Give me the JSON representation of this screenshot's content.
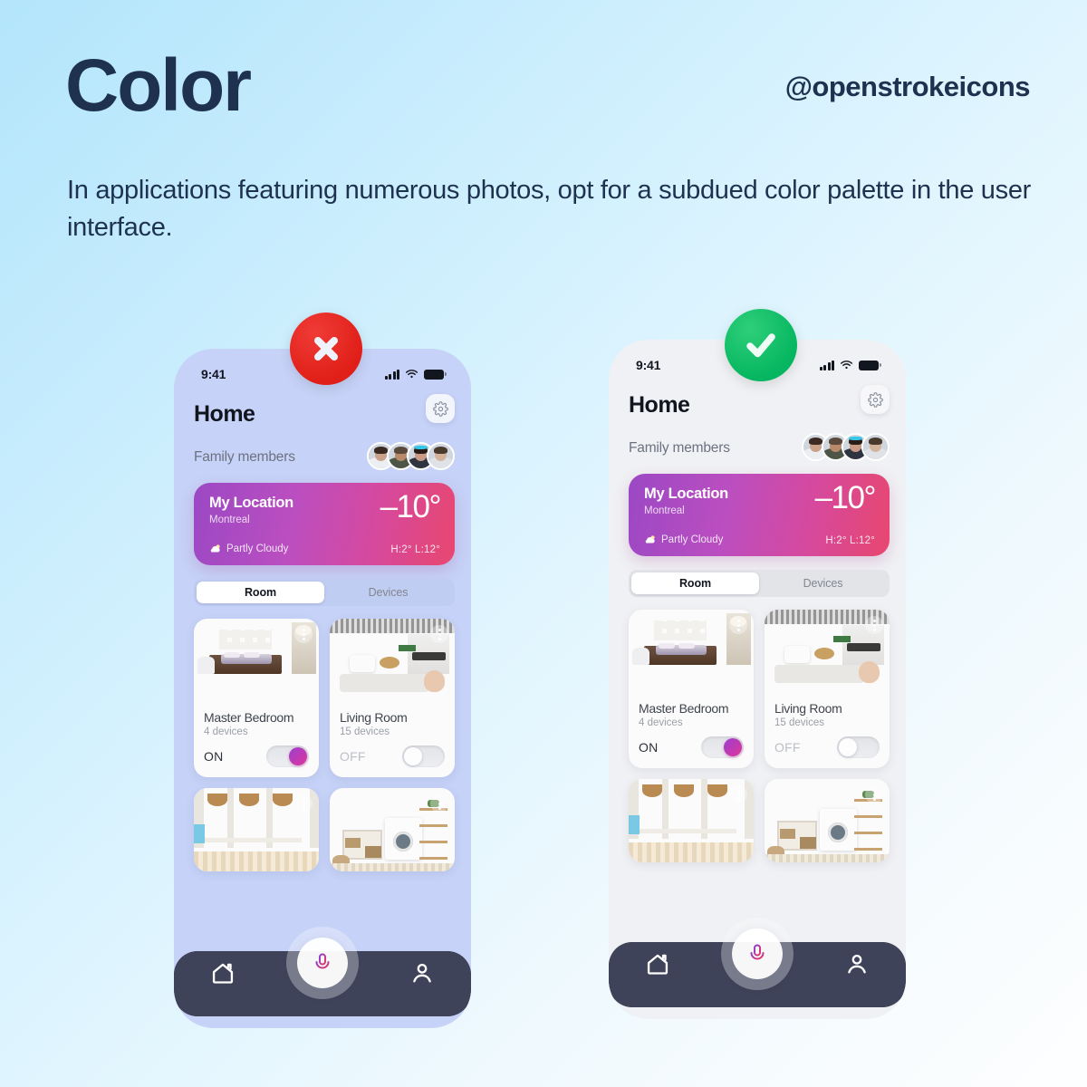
{
  "header": {
    "title": "Color",
    "handle": "@openstrokeicons",
    "subtitle": "In applications featuring numerous photos, opt for a subdued color palette in the user interface."
  },
  "colors": {
    "page_bg_start": "#b3e5fb",
    "page_bg_end": "#fdfeff",
    "ink": "#1e3250",
    "bad_badge": "#e01f18",
    "good_badge": "#05b55f",
    "weather_gradient_start": "#9b48c4",
    "weather_gradient_end": "#e8476f",
    "nav_bar": "#3e4359",
    "toggle_on": "#e0369a",
    "phone_left_bg": "#c6d2f7",
    "phone_right_bg": "#f0f1f4"
  },
  "badges": {
    "bad": {
      "icon": "cross-icon",
      "label": "Incorrect example"
    },
    "good": {
      "icon": "check-icon",
      "label": "Correct example"
    }
  },
  "app": {
    "status_bar": {
      "time": "9:41",
      "signal_icon": "cellular-bars-icon",
      "wifi_icon": "wifi-icon",
      "battery_icon": "battery-full-icon"
    },
    "title": "Home",
    "settings_icon": "gear-icon",
    "family": {
      "label": "Family members",
      "avatar_count": 4
    },
    "weather": {
      "location": "My Location",
      "city": "Montreal",
      "temperature": "–10°",
      "condition": "Partly Cloudy",
      "condition_icon": "partly-cloudy-icon",
      "high_low": "H:2°  L:12°"
    },
    "tabs": [
      {
        "label": "Room",
        "active": true
      },
      {
        "label": "Devices",
        "active": false
      }
    ],
    "rooms": [
      {
        "name": "Master Bedroom",
        "devices": "4 devices",
        "state": "ON",
        "on": true,
        "menu_icon": "more-vertical-icon",
        "photo": "bedroom"
      },
      {
        "name": "Living Room",
        "devices": "15 devices",
        "state": "OFF",
        "on": false,
        "menu_icon": "more-vertical-icon",
        "photo": "livingroom"
      },
      {
        "name": "",
        "devices": "",
        "state": "",
        "on": false,
        "menu_icon": "more-vertical-icon",
        "photo": "patio"
      },
      {
        "name": "",
        "devices": "",
        "state": "",
        "on": false,
        "menu_icon": "more-vertical-icon",
        "photo": "laundry"
      }
    ],
    "bottom_nav": {
      "home_icon": "home-icon",
      "profile_icon": "person-icon",
      "mic_icon": "microphone-icon"
    }
  }
}
